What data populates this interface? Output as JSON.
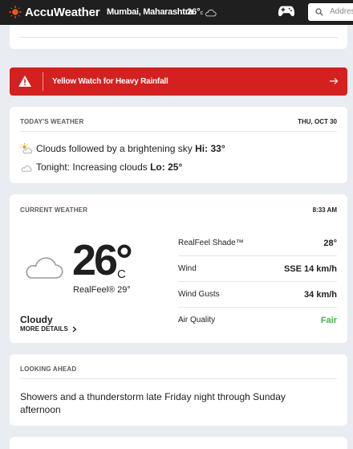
{
  "header": {
    "brand": "AccuWeather",
    "location": "Mumbai, Maharashtra",
    "temp": "26°",
    "temp_unit": "c",
    "search_placeholder": "Address"
  },
  "alert": {
    "text": "Yellow Watch for Heavy Rainfall",
    "color": "#d4201f"
  },
  "todays_weather": {
    "label": "TODAY'S WEATHER",
    "date": "THU, OCT 30",
    "day": {
      "text": "Clouds followed by a brightening sky",
      "hi_label": "Hi:",
      "hi": "33°",
      "icon": "partly-sunny-icon"
    },
    "night": {
      "text": "Tonight: Increasing clouds",
      "lo_label": "Lo:",
      "lo": "25°",
      "icon": "cloudy-night-icon"
    }
  },
  "current_weather": {
    "label": "CURRENT WEATHER",
    "time": "8:33 AM",
    "temp": "26°",
    "unit": "C",
    "realfeel": "RealFeel® 29°",
    "condition": "Cloudy",
    "more_details": "MORE DETAILS",
    "details": [
      {
        "label": "RealFeel Shade™",
        "value": "28°"
      },
      {
        "label": "Wind",
        "value": "SSE 14 km/h"
      },
      {
        "label": "Wind Gusts",
        "value": "34 km/h"
      },
      {
        "label": "Air Quality",
        "value": "Fair",
        "color": "#3fb34f"
      }
    ]
  },
  "looking_ahead": {
    "label": "LOOKING AHEAD",
    "text": "Showers and a thunderstorm late Friday night through Sunday afternoon"
  },
  "colors": {
    "brand_orange": "#f05514",
    "header_bg": "#1f1f1f",
    "page_bg": "#e9edf2"
  }
}
